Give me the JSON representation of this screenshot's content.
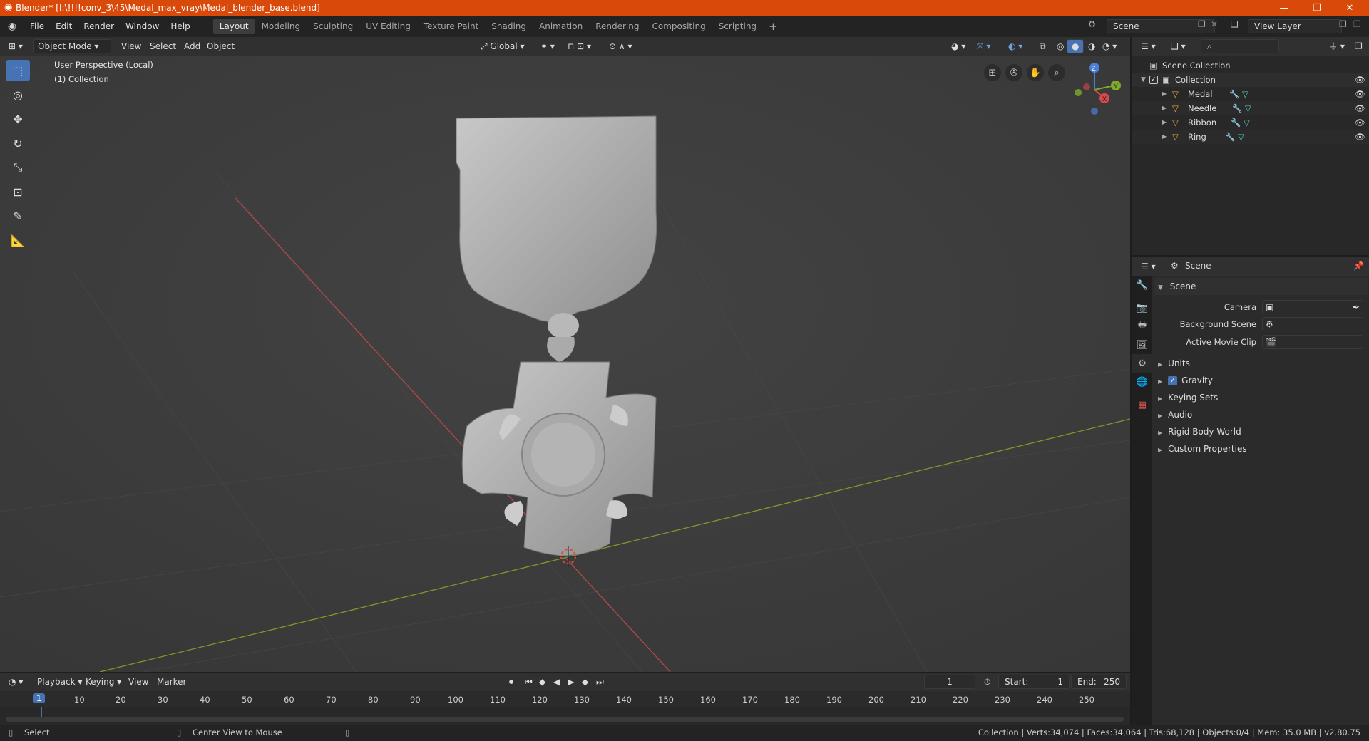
{
  "window": {
    "title": "Blender* [I:\\!!!!conv_3\\45\\Medal_max_vray\\Medal_blender_base.blend]",
    "min": "—",
    "max": "❐",
    "close": "✕"
  },
  "menu": [
    "File",
    "Edit",
    "Render",
    "Window",
    "Help"
  ],
  "workspaces": [
    "Layout",
    "Modeling",
    "Sculpting",
    "UV Editing",
    "Texture Paint",
    "Shading",
    "Animation",
    "Rendering",
    "Compositing",
    "Scripting"
  ],
  "workspace_active": "Layout",
  "scene_field": "Scene",
  "viewlayer_field": "View Layer",
  "viewport": {
    "mode": "Object Mode",
    "menus": [
      "View",
      "Select",
      "Add",
      "Object"
    ],
    "orientation": "Global",
    "overlay_line1": "User Perspective (Local)",
    "overlay_line2": "(1) Collection",
    "gizmo": {
      "z": "Z",
      "y": "Y",
      "x": "X"
    }
  },
  "outliner": {
    "root": "Scene Collection",
    "collection": "Collection",
    "objects": [
      "Medal",
      "Needle",
      "Ribbon",
      "Ring"
    ]
  },
  "properties": {
    "header": "Scene",
    "panel": "Scene",
    "camera_label": "Camera",
    "bg_scene_label": "Background Scene",
    "movie_clip_label": "Active Movie Clip",
    "sections": [
      "Units",
      "Gravity",
      "Keying Sets",
      "Audio",
      "Rigid Body World",
      "Custom Properties"
    ],
    "gravity_checked": true
  },
  "timeline": {
    "menus": [
      "Playback",
      "Keying",
      "View",
      "Marker"
    ],
    "current_frame": "1",
    "start_label": "Start:",
    "start": "1",
    "end_label": "End:",
    "end": "250",
    "ticks": [
      "1",
      "10",
      "20",
      "30",
      "40",
      "50",
      "60",
      "70",
      "80",
      "90",
      "100",
      "110",
      "120",
      "130",
      "140",
      "150",
      "160",
      "170",
      "180",
      "190",
      "200",
      "210",
      "220",
      "230",
      "240",
      "250"
    ]
  },
  "status": {
    "left": "Select",
    "middle": "Center View to Mouse",
    "right": "Collection | Verts:34,074 | Faces:34,064 | Tris:68,128 | Objects:0/4 | Mem: 35.0 MB | v2.80.75"
  },
  "colors": {
    "titlebar": "#d94a0a",
    "accent": "#4772b3",
    "object_icon": "#e8a23c",
    "modifier_icon": "#6fa3e0",
    "mesh_icon": "#4fd1b7"
  }
}
